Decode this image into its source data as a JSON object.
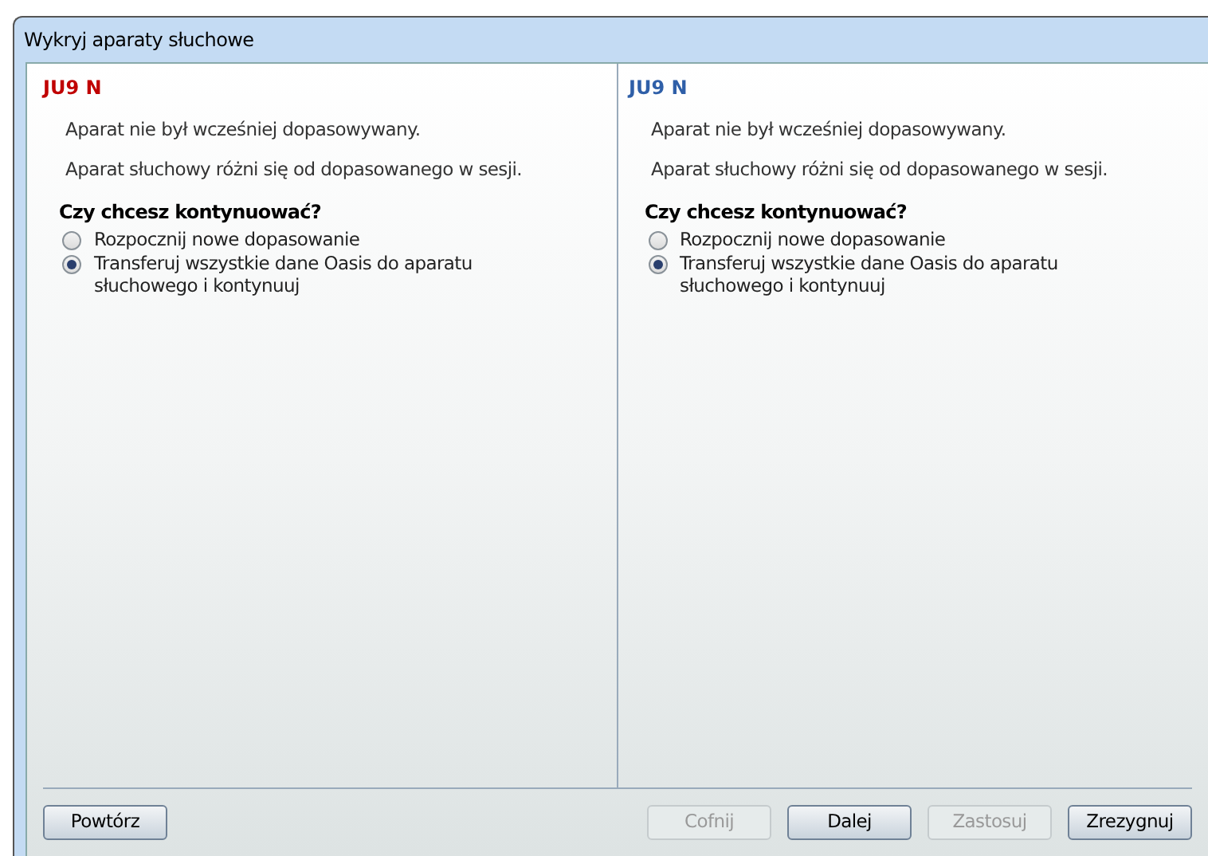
{
  "window": {
    "title": "Wykryj aparaty słuchowe"
  },
  "panels": [
    {
      "device": "JU9 N",
      "color": "#c00000",
      "messages": [
        "Aparat nie był wcześniej dopasowywany.",
        "Aparat słuchowy różni się od dopasowanego w sesji."
      ],
      "question": "Czy chcesz kontynuować?",
      "options": [
        {
          "label": "Rozpocznij nowe dopasowanie",
          "selected": false
        },
        {
          "label": "Transferuj wszystkie dane Oasis do aparatu słuchowego i kontynuuj",
          "selected": true
        }
      ]
    },
    {
      "device": "JU9 N",
      "color": "#2f5fa8",
      "messages": [
        "Aparat nie był wcześniej dopasowywany.",
        "Aparat słuchowy różni się od dopasowanego w sesji."
      ],
      "question": "Czy chcesz kontynuować?",
      "options": [
        {
          "label": "Rozpocznij nowe dopasowanie",
          "selected": false
        },
        {
          "label": "Transferuj wszystkie dane Oasis do aparatu słuchowego i kontynuuj",
          "selected": true
        }
      ]
    }
  ],
  "buttons": [
    {
      "label": "Powtórz",
      "disabled": false
    },
    {
      "label": "Cofnij",
      "disabled": true
    },
    {
      "label": "Dalej",
      "disabled": false
    },
    {
      "label": "Zastosuj",
      "disabled": true
    },
    {
      "label": "Zrezygnuj",
      "disabled": false
    }
  ]
}
